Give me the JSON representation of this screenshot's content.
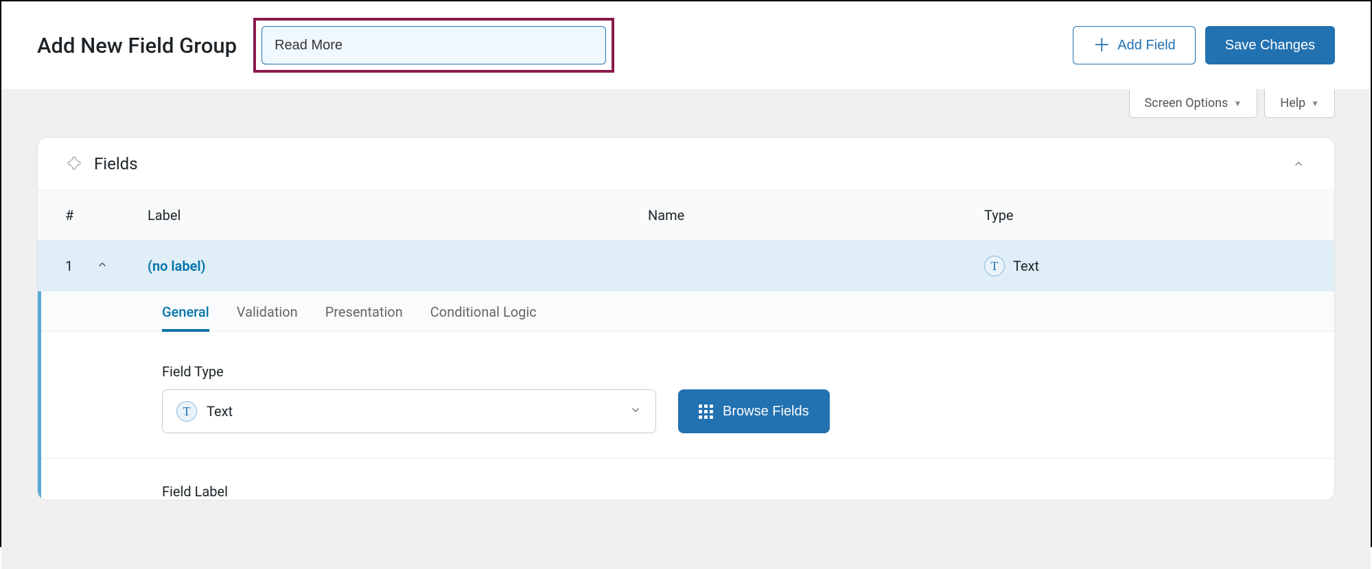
{
  "header": {
    "title": "Add New Field Group",
    "group_name_value": "Read More",
    "add_field_label": "Add Field",
    "save_label": "Save Changes"
  },
  "screen_tabs": {
    "screen_options": "Screen Options",
    "help": "Help"
  },
  "panel": {
    "title": "Fields",
    "columns": {
      "num": "#",
      "label": "Label",
      "name": "Name",
      "type": "Type"
    }
  },
  "row": {
    "index": "1",
    "label": "(no label)",
    "name": "",
    "type": "Text",
    "type_icon": "T"
  },
  "editor": {
    "tabs": {
      "general": "General",
      "validation": "Validation",
      "presentation": "Presentation",
      "conditional": "Conditional Logic"
    },
    "field_type_label": "Field Type",
    "field_type_value": "Text",
    "field_type_icon": "T",
    "browse_label": "Browse Fields",
    "next_label": "Field Label"
  }
}
